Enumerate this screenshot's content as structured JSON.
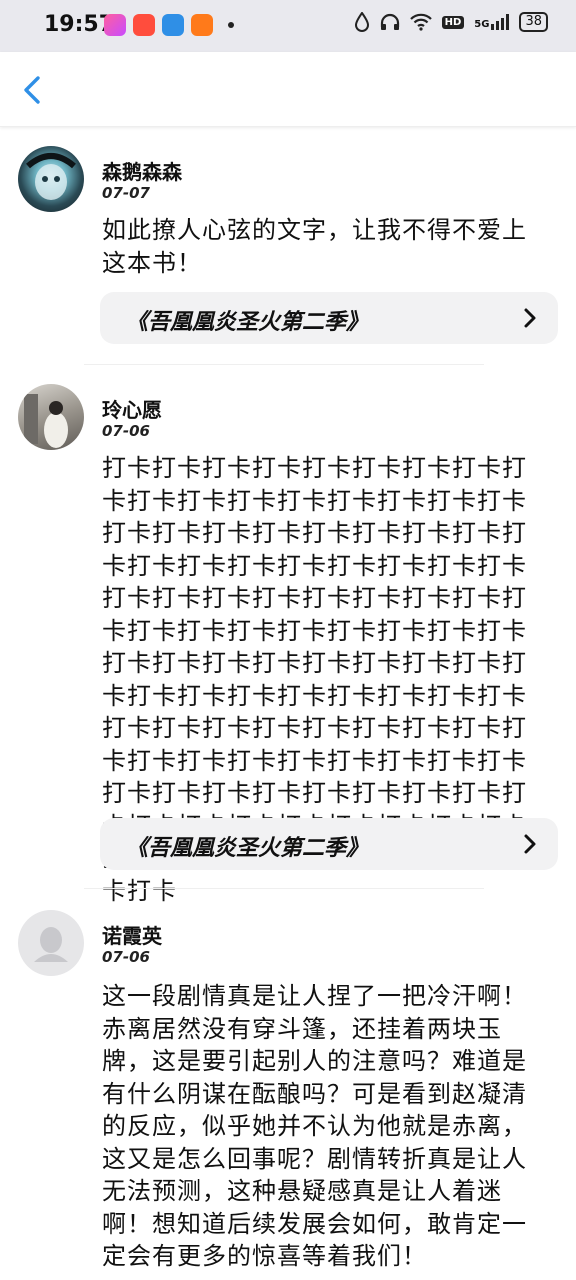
{
  "status_bar": {
    "time": "19:57",
    "battery": "38",
    "network": "5G",
    "hd": "HD"
  },
  "colors": {
    "accent": "#2f8fe6",
    "card_bg": "#f2f2f3",
    "status_bg": "#e9e9ee"
  },
  "comments": [
    {
      "username": "森鹅森森",
      "date": "07-07",
      "text": "如此撩人心弦的文字，让我不得不爱上这本书！",
      "book": "《吾凰凰炎圣火第二季》"
    },
    {
      "username": "玲心愿",
      "date": "07-06",
      "text": "打卡打卡打卡打卡打卡打卡打卡打卡打卡打卡打卡打卡打卡打卡打卡打卡打卡打卡打卡打卡打卡打卡打卡打卡打卡打卡打卡打卡打卡打卡打卡打卡打卡打卡打卡打卡打卡打卡打卡打卡打卡打卡打卡打卡打卡打卡打卡打卡打卡打卡打卡打卡打卡打卡打卡打卡打卡打卡打卡打卡打卡打卡打卡打卡打卡打卡打卡打卡打卡打卡打卡打卡打卡打卡打卡打卡打卡打卡打卡打卡打卡打卡打卡打卡打卡打卡打卡打卡打卡打卡打卡打卡打卡打卡打卡打卡打卡打卡打卡打卡打卡打卡打卡打卡打卡打卡打卡打卡打卡打卡打卡打卡",
      "book": "《吾凰凰炎圣火第二季》"
    },
    {
      "username": "诺霞英",
      "date": "07-06",
      "text": "这一段剧情真是让人捏了一把冷汗啊！赤离居然没有穿斗篷，还挂着两块玉牌，这是要引起别人的注意吗？难道是有什么阴谋在酝酿吗？可是看到赵凝清的反应，似乎她并不认为他就是赤离，这又是怎么回事呢？剧情转折真是让人无法预测，这种悬疑感真是让人着迷啊！想知道后续发展会如何，敢肯定一定会有更多的惊喜等着我们！"
    }
  ]
}
